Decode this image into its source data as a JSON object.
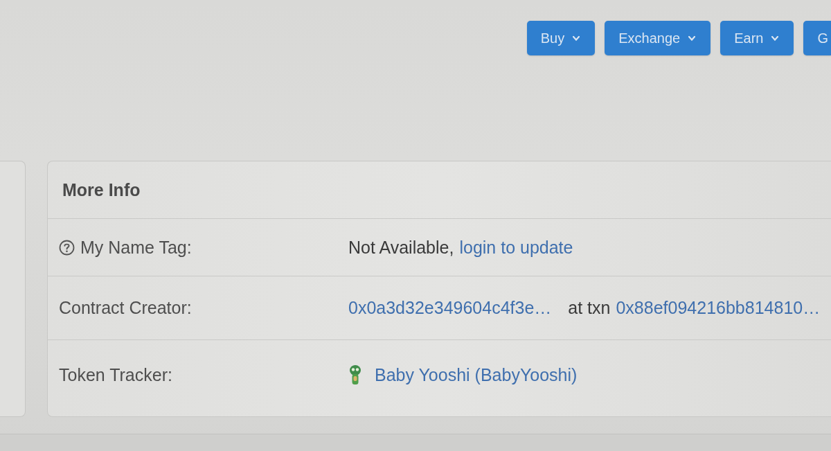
{
  "header": {
    "buttons": [
      {
        "label": "Buy",
        "caret": true
      },
      {
        "label": "Exchange",
        "caret": true
      },
      {
        "label": "Earn",
        "caret": true
      },
      {
        "label": "G",
        "caret": false
      }
    ]
  },
  "card": {
    "title": "More Info",
    "rows": [
      {
        "label": "My Name Tag:",
        "help": true,
        "value": [
          {
            "kind": "text",
            "text": "Not Available,"
          },
          {
            "kind": "link",
            "text": "login to update"
          }
        ]
      },
      {
        "label": "Contract Creator:",
        "help": false,
        "value": [
          {
            "kind": "link",
            "text": "0x0a3d32e349604c4f3e…"
          },
          {
            "kind": "text",
            "text": "at txn"
          },
          {
            "kind": "link",
            "text": "0x88ef094216bb814810…"
          }
        ]
      },
      {
        "label": "Token Tracker:",
        "help": false,
        "value": [
          {
            "kind": "token",
            "text": "Baby Yooshi (BabyYooshi)"
          }
        ]
      }
    ]
  }
}
